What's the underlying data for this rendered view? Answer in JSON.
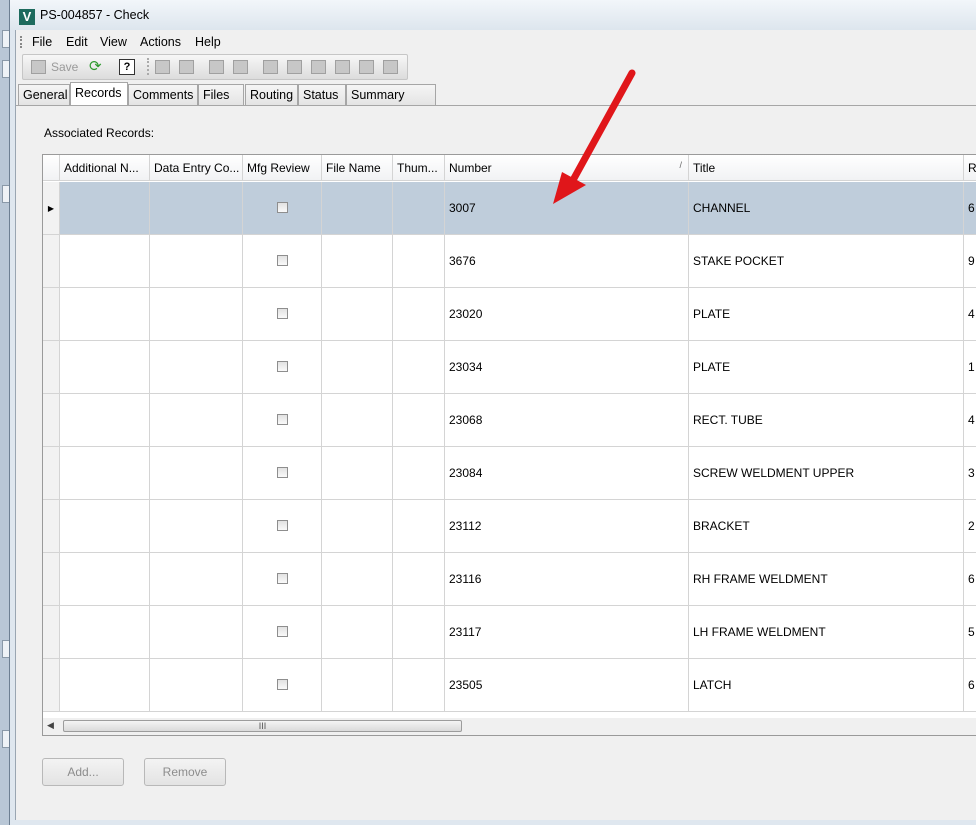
{
  "window": {
    "title": "PS-004857 - Check"
  },
  "menu": [
    "File",
    "Edit",
    "View",
    "Actions",
    "Help"
  ],
  "toolbar": {
    "save_label": "Save",
    "help_glyph": "?"
  },
  "tabs": [
    "General",
    "Records",
    "Comments",
    "Files",
    "Routing",
    "Status",
    "Summary Page"
  ],
  "active_tab": "Records",
  "records": {
    "label": "Associated Records:",
    "columns": [
      "Additional N...",
      "Data Entry Co...",
      "Mfg Review",
      "File Name",
      "Thum...",
      "Number",
      "Title",
      "Re"
    ],
    "sorted_column": "Number",
    "rows": [
      {
        "number": "3007",
        "title": "CHANNEL",
        "rev": "6",
        "selected": true
      },
      {
        "number": "3676",
        "title": "STAKE POCKET",
        "rev": "9"
      },
      {
        "number": "23020",
        "title": "PLATE",
        "rev": "4"
      },
      {
        "number": "23034",
        "title": "PLATE",
        "rev": "1"
      },
      {
        "number": "23068",
        "title": "RECT. TUBE",
        "rev": "4"
      },
      {
        "number": "23084",
        "title": "SCREW WELDMENT UPPER",
        "rev": "3"
      },
      {
        "number": "23112",
        "title": "BRACKET",
        "rev": "2"
      },
      {
        "number": "23116",
        "title": "RH FRAME WELDMENT",
        "rev": "6"
      },
      {
        "number": "23117",
        "title": "LH FRAME WELDMENT",
        "rev": "5"
      },
      {
        "number": "23505",
        "title": "LATCH",
        "rev": "6"
      }
    ],
    "scroll_grip": "III"
  },
  "buttons": {
    "add": "Add...",
    "remove": "Remove"
  },
  "colors": {
    "selected_row": "#bfcddb",
    "annotation_arrow": "#e0161a"
  }
}
